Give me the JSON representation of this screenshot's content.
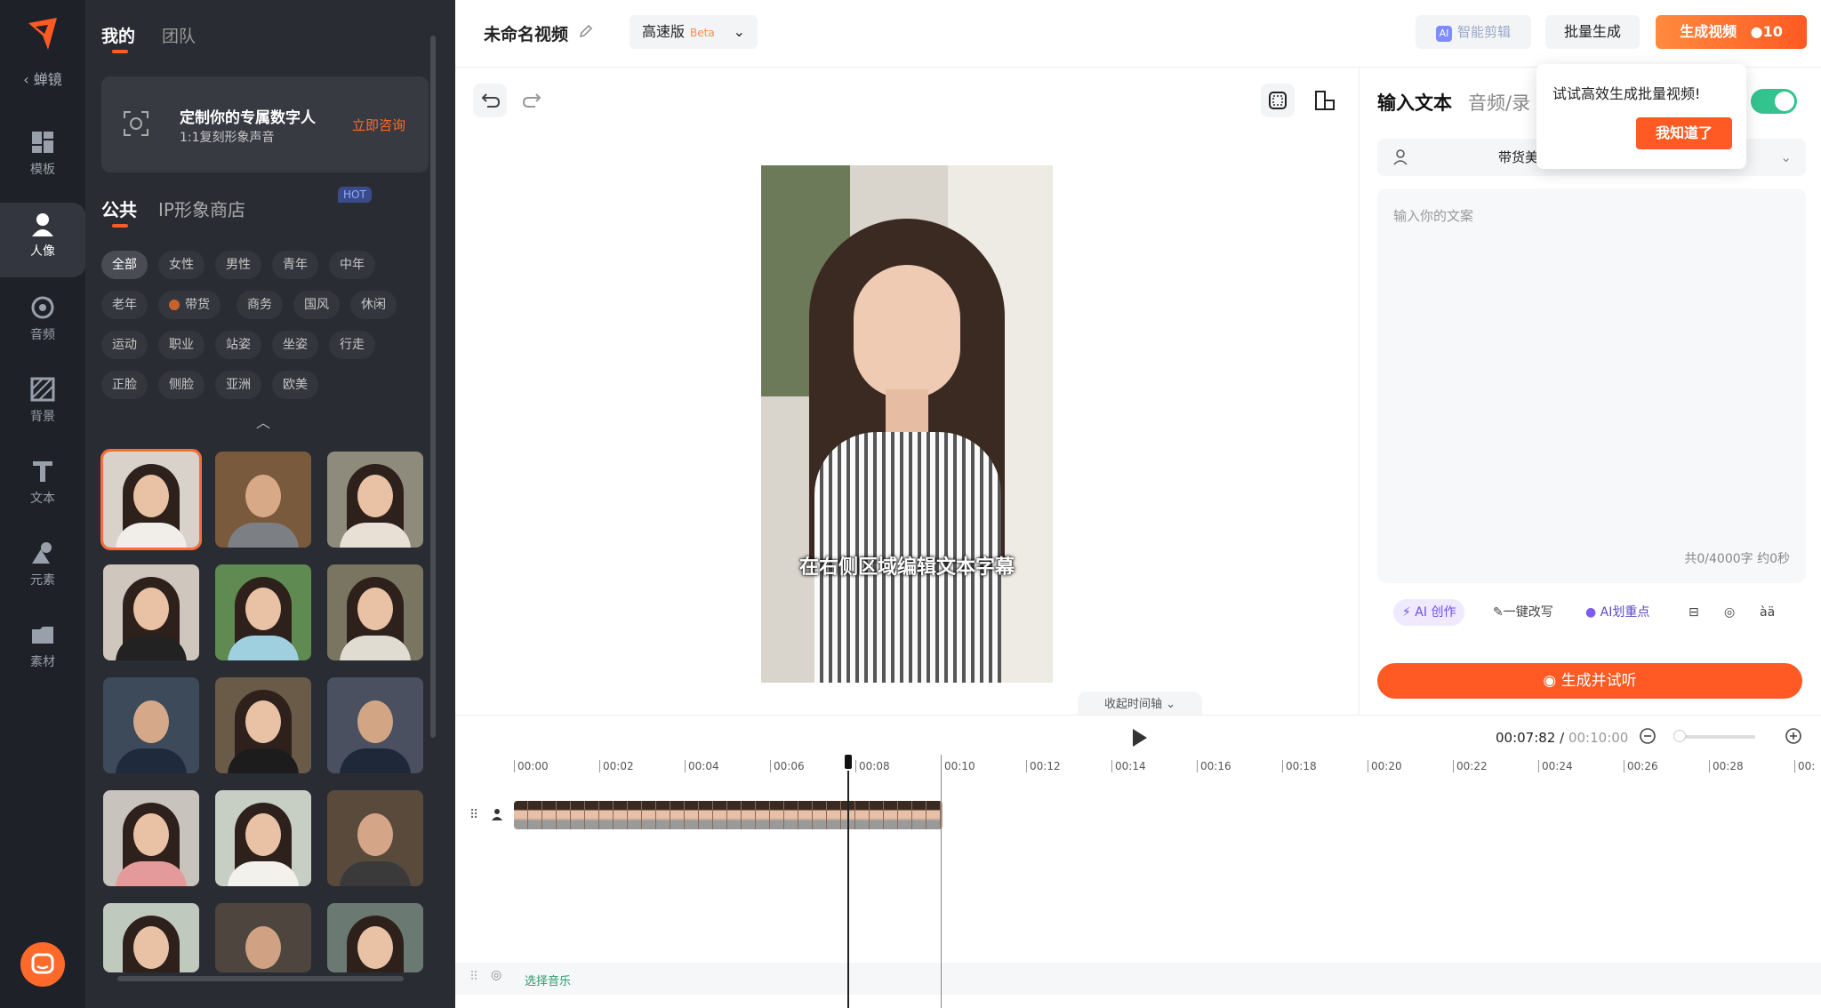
{
  "rail": {
    "back": "‹ 蝉镜",
    "items": [
      {
        "label": "模板",
        "icon": "template-icon"
      },
      {
        "label": "人像",
        "icon": "portrait-icon"
      },
      {
        "label": "音频",
        "icon": "audio-icon"
      },
      {
        "label": "背景",
        "icon": "background-icon"
      },
      {
        "label": "文本",
        "icon": "text-icon"
      },
      {
        "label": "元素",
        "icon": "elements-icon"
      },
      {
        "label": "素材",
        "icon": "assets-icon"
      }
    ],
    "active": "人像"
  },
  "panel": {
    "top_tabs": [
      "我的",
      "团队"
    ],
    "promo": {
      "title": "定制你的专属数字人",
      "sub": "1:1复刻形象声音",
      "cta": "立即咨询"
    },
    "tabs": [
      "公共",
      "IP形象商店"
    ],
    "hot": "HOT",
    "tags": [
      [
        "全部",
        "女性",
        "男性",
        "青年",
        "中年"
      ],
      [
        "老年",
        "带货",
        "商务",
        "国风",
        "休闲"
      ],
      [
        "运动",
        "职业",
        "站姿",
        "坐姿",
        "行走"
      ],
      [
        "正脸",
        "侧脸",
        "亚洲",
        "欧美"
      ]
    ]
  },
  "topbar": {
    "title": "未命名视频",
    "mode": "高速版",
    "beta": "Beta",
    "ai_edit": "智能剪辑",
    "batch": "批量生成",
    "generate": "生成视频",
    "credits": "10"
  },
  "preview": {
    "subtitle": "在右侧区域编辑文本字幕"
  },
  "right": {
    "tabs": [
      "输入文本",
      "音频/录"
    ],
    "voice": "带货美",
    "placeholder": "输入你的文案",
    "count": "共0/4000字 约0秒",
    "tools": {
      "ai_create": "AI 创作",
      "rewrite": "一键改写",
      "highlight": "AI划重点",
      "glyph": "àä"
    },
    "gen_listen": "生成并试听"
  },
  "popover": {
    "msg": "试试高效生成批量视频!",
    "ok": "我知道了"
  },
  "timeline": {
    "toggle": "收起时间轴",
    "current": "00:07:82",
    "total": "00:10:00",
    "ticks": [
      "00:00",
      "00:02",
      "00:04",
      "00:06",
      "00:08",
      "00:10",
      "00:12",
      "00:14",
      "00:16",
      "00:18",
      "00:20",
      "00:22",
      "00:24",
      "00:26",
      "00:28",
      "00:"
    ],
    "music": "选择音乐"
  },
  "colors": {
    "accent": "#ff5a23",
    "rail_bg": "#1f2128",
    "panel_bg": "#2a2c33",
    "toggle_on": "#34c38f"
  }
}
